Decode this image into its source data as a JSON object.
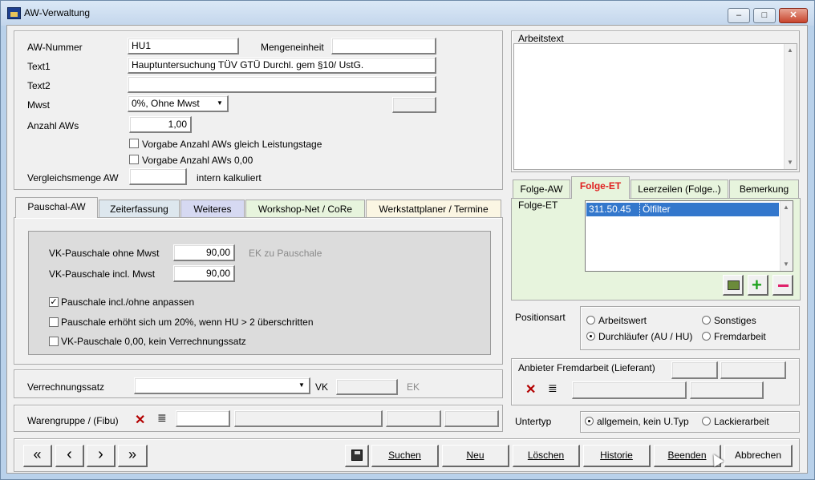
{
  "window": {
    "title": "AW-Verwaltung",
    "controls": {
      "minimize": "–",
      "maximize": "□",
      "close": "✕"
    }
  },
  "top": {
    "aw_nummer_label": "AW-Nummer",
    "aw_nummer_value": "HU1",
    "mengeneinheit_label": "Mengeneinheit",
    "mengeneinheit_value": "",
    "text1_label": "Text1",
    "text1_value": "Hauptuntersuchung TÜV GTÜ Durchl. gem §10/ UstG.",
    "text2_label": "Text2",
    "text2_value": "",
    "mwst_label": "Mwst",
    "mwst_value": "0%, Ohne Mwst",
    "anzahl_label": "Anzahl AWs",
    "anzahl_value": "1,00",
    "vorgabe1_label": "Vorgabe Anzahl AWs gleich Leistungstage",
    "vorgabe2_label": "Vorgabe Anzahl AWs 0,00",
    "vergleich_label": "Vergleichsmenge AW",
    "vergleich_value": "",
    "intern_label": "intern kalkuliert"
  },
  "tabs": [
    {
      "label": "Pauschal-AW",
      "color": "#f0f0f0"
    },
    {
      "label": "Zeiterfassung",
      "color": "#dde7ee"
    },
    {
      "label": "Weiteres",
      "color": "#d6d9f2"
    },
    {
      "label": "Workshop-Net / CoRe",
      "color": "#e7f4dd"
    },
    {
      "label": "Werkstattplaner / Termine",
      "color": "#fbf6e3"
    }
  ],
  "pauschal": {
    "vk_ohne_label": "VK-Pauschale ohne Mwst",
    "vk_ohne_value": "90,00",
    "ek_label": "EK zu Pauschale",
    "vk_incl_label": "VK-Pauschale incl. Mwst",
    "vk_incl_value": "90,00",
    "chk1_label": "Pauschale incl./ohne anpassen",
    "chk1_mark": "✓",
    "chk2_label": "Pauschale erhöht sich um 20%, wenn HU > 2 überschritten",
    "chk3_label": "VK-Pauschale 0,00, kein Verrechnungssatz"
  },
  "verrechnung": {
    "label": "Verrechnungssatz",
    "value": "",
    "vk_label": "VK",
    "ek_label": "EK"
  },
  "warengruppe": {
    "label": "Warengruppe / (Fibu)"
  },
  "arbeitstext": {
    "label": "Arbeitstext",
    "value": ""
  },
  "right_tabs": [
    {
      "label": "Folge-AW"
    },
    {
      "label": "Folge-ET"
    },
    {
      "label": "Leerzeilen (Folge..)"
    },
    {
      "label": "Bemerkung"
    }
  ],
  "folge_et": {
    "label": "Folge-ET",
    "rows": [
      {
        "nr": "311.50.45",
        "name": "Ölfilter"
      }
    ]
  },
  "positionsart": {
    "label": "Positionsart",
    "options": [
      "Arbeitswert",
      "Sonstiges",
      "Durchläufer (AU / HU)",
      "Fremdarbeit"
    ]
  },
  "anbieter": {
    "label": "Anbieter Fremdarbeit (Lieferant)"
  },
  "untertyp": {
    "label": "Untertyp",
    "options": [
      "allgemein, kein U.Typ",
      "Lackierarbeit"
    ]
  },
  "nav": {
    "first": "«",
    "prev": "‹",
    "next": "›",
    "last": "»"
  },
  "buttons": {
    "suchen": "Suchen",
    "neu": "Neu",
    "loeschen": "Löschen",
    "historie": "Historie",
    "beenden": "Beenden",
    "abbrechen": "Abbrechen"
  }
}
